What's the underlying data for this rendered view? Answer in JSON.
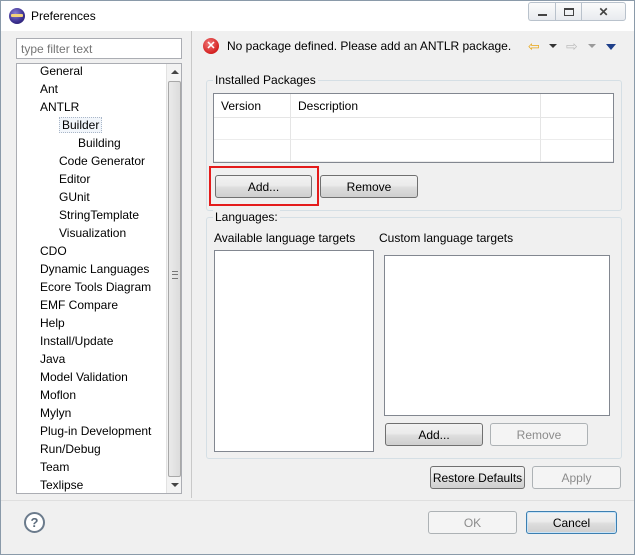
{
  "window": {
    "title": "Preferences"
  },
  "filter": {
    "placeholder": "type filter text"
  },
  "tree": {
    "items": [
      {
        "label": "General",
        "level": 0
      },
      {
        "label": "Ant",
        "level": 0
      },
      {
        "label": "ANTLR",
        "level": 0
      },
      {
        "label": "Builder",
        "level": 1,
        "selected": true
      },
      {
        "label": "Building",
        "level": 2
      },
      {
        "label": "Code Generator",
        "level": 1
      },
      {
        "label": "Editor",
        "level": 1
      },
      {
        "label": "GUnit",
        "level": 1
      },
      {
        "label": "StringTemplate",
        "level": 1
      },
      {
        "label": "Visualization",
        "level": 1
      },
      {
        "label": "CDO",
        "level": 0
      },
      {
        "label": "Dynamic Languages",
        "level": 0
      },
      {
        "label": "Ecore Tools Diagram",
        "level": 0
      },
      {
        "label": "EMF Compare",
        "level": 0
      },
      {
        "label": "Help",
        "level": 0
      },
      {
        "label": "Install/Update",
        "level": 0
      },
      {
        "label": "Java",
        "level": 0
      },
      {
        "label": "Model Validation",
        "level": 0
      },
      {
        "label": "Moflon",
        "level": 0
      },
      {
        "label": "Mylyn",
        "level": 0
      },
      {
        "label": "Plug-in Development",
        "level": 0
      },
      {
        "label": "Run/Debug",
        "level": 0
      },
      {
        "label": "Team",
        "level": 0
      },
      {
        "label": "Texlipse",
        "level": 0
      }
    ]
  },
  "message": {
    "text": "No package defined. Please add an ANTLR package."
  },
  "installed": {
    "title": "Installed Packages",
    "columns": [
      "Version",
      "Description",
      ""
    ],
    "add_label": "Add...",
    "remove_label": "Remove"
  },
  "languages": {
    "title": "Languages:",
    "available_title": "Available language targets",
    "custom_title": "Custom language targets",
    "add_label": "Add...",
    "remove_label": "Remove"
  },
  "footer": {
    "restore_defaults_label": "Restore Defaults",
    "apply_label": "Apply",
    "ok_label": "OK",
    "cancel_label": "Cancel"
  },
  "colors": {
    "highlight": "#e41b1b",
    "error": "#d42020",
    "back_arrow": "#e8a718"
  }
}
